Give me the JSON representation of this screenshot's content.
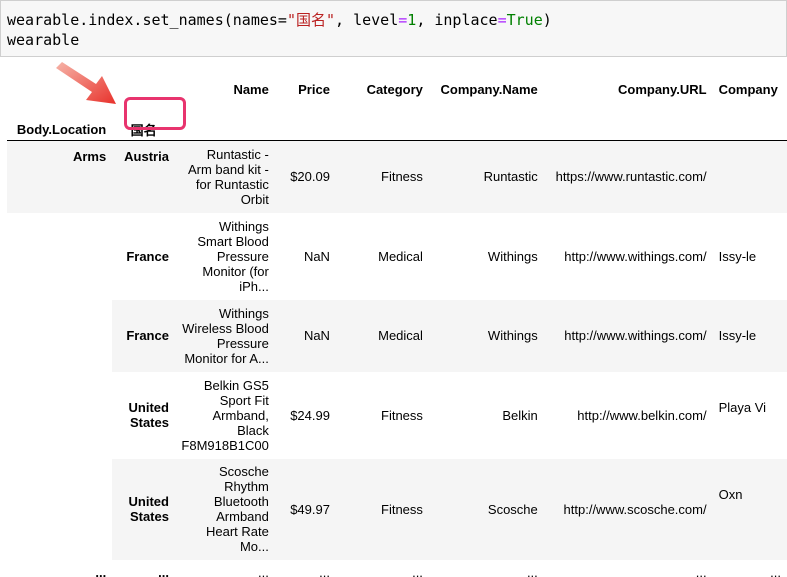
{
  "code": {
    "line1_prefix": "wearable.index.set_names(names=",
    "line1_str": "\"国名\"",
    "line1_mid": ", level",
    "line1_eq1": "=",
    "line1_num": "1",
    "line1_mid2": ", inplace",
    "line1_eq2": "=",
    "line1_kw": "True",
    "line1_end": ")",
    "line2": "wearable"
  },
  "table": {
    "index_names": [
      "Body.Location",
      "国名"
    ],
    "columns": [
      "Name",
      "Price",
      "Category",
      "Company.Name",
      "Company.URL",
      "Company"
    ],
    "rows": [
      {
        "level0": "Arms",
        "level1": "Austria",
        "name": "Runtastic - Arm band kit - for Runtastic Orbit",
        "price": "$20.09",
        "category": "Fitness",
        "company_name": "Runtastic",
        "company_url": "https://www.runtastic.com/",
        "company_extra": ""
      },
      {
        "level0": "",
        "level1": "France",
        "name": "Withings Smart Blood Pressure Monitor (for iPh...",
        "price": "NaN",
        "category": "Medical",
        "company_name": "Withings",
        "company_url": "http://www.withings.com/",
        "company_extra": "Issy-le"
      },
      {
        "level0": "",
        "level1": "France",
        "name": "Withings Wireless Blood Pressure Monitor for A...",
        "price": "NaN",
        "category": "Medical",
        "company_name": "Withings",
        "company_url": "http://www.withings.com/",
        "company_extra": "Issy-le"
      },
      {
        "level0": "",
        "level1": "United States",
        "name": "Belkin GS5 Sport Fit Armband, Black F8M918B1C00",
        "price": "$24.99",
        "category": "Fitness",
        "company_name": "Belkin",
        "company_url": "http://www.belkin.com/",
        "company_extra": "Playa Vi"
      },
      {
        "level0": "",
        "level1": "United States",
        "name": "Scosche Rhythm Bluetooth Armband Heart Rate Mo...",
        "price": "$49.97",
        "category": "Fitness",
        "company_name": "Scosche",
        "company_url": "http://www.scosche.com/",
        "company_extra": "Oxn"
      }
    ],
    "ellipsis": "..."
  },
  "annotation": {
    "arrow_color": "#e8346e",
    "box_color": "#e8346e"
  }
}
